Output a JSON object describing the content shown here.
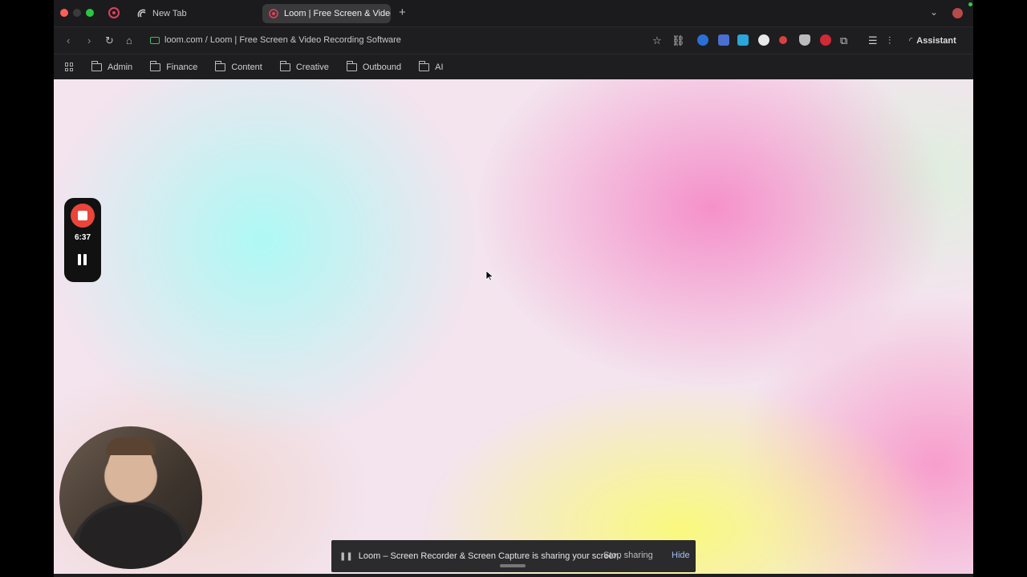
{
  "tabs": {
    "new_tab_label": "New Tab",
    "active_tab_label": "Loom | Free Screen & Video"
  },
  "address": {
    "url_text": "loom.com / Loom | Free Screen & Video Recording Software",
    "assistant_label": "Assistant"
  },
  "bookmarks": [
    {
      "label": "Admin"
    },
    {
      "label": "Finance"
    },
    {
      "label": "Content"
    },
    {
      "label": "Creative"
    },
    {
      "label": "Outbound"
    },
    {
      "label": "AI"
    }
  ],
  "loom": {
    "timer": "6:37"
  },
  "share_banner": {
    "message": "Loom – Screen Recorder & Screen Capture is sharing your screen.",
    "stop_label": "Stop sharing",
    "hide_label": "Hide"
  },
  "colors": {
    "loom_red": "#e9453a",
    "accent_link": "#9fc1f5"
  }
}
